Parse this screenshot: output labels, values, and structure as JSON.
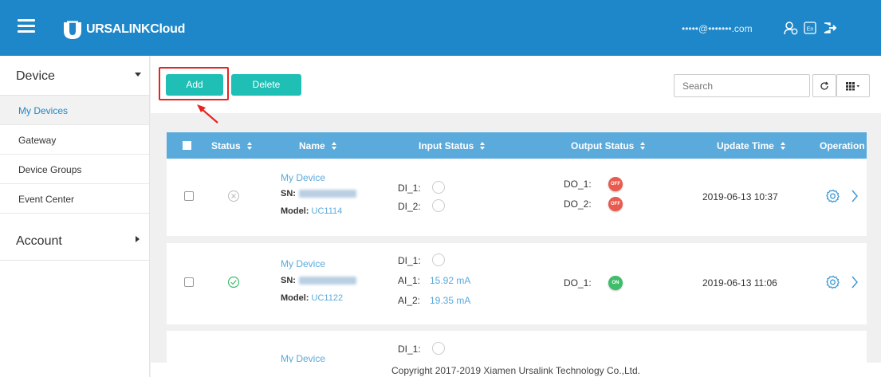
{
  "header": {
    "logo_text": "URSALINKCloud",
    "user_email": "•••••@•••••••.com",
    "icons": [
      "menu-icon",
      "user-switch-icon",
      "language-en-icon",
      "logout-icon"
    ],
    "lang_label": "En"
  },
  "sidebar": {
    "device_section": "Device",
    "items": [
      {
        "label": "My Devices",
        "active": true
      },
      {
        "label": "Gateway",
        "active": false
      },
      {
        "label": "Device Groups",
        "active": false
      },
      {
        "label": "Event Center",
        "active": false
      }
    ],
    "account_section": "Account"
  },
  "toolbar": {
    "add_label": "Add",
    "delete_label": "Delete",
    "search_placeholder": "Search"
  },
  "table": {
    "columns": [
      "Status",
      "Name",
      "Input Status",
      "Output Status",
      "Update Time",
      "Operation"
    ],
    "rows": [
      {
        "status": "offline",
        "name": "My Device",
        "sn_label": "SN:",
        "model_label": "Model:",
        "model": "UC1114",
        "inputs": [
          {
            "label": "DI_1:"
          },
          {
            "label": "DI_2:"
          }
        ],
        "outputs": [
          {
            "label": "DO_1:",
            "state": "OFF"
          },
          {
            "label": "DO_2:",
            "state": "OFF"
          }
        ],
        "update_time": "2019-06-13 10:37"
      },
      {
        "status": "online",
        "name": "My Device",
        "sn_label": "SN:",
        "model_label": "Model:",
        "model": "UC1122",
        "inputs": [
          {
            "label": "DI_1:"
          },
          {
            "label": "AI_1:",
            "value": "15.92 mA"
          },
          {
            "label": "AI_2:",
            "value": "19.35 mA"
          }
        ],
        "outputs": [
          {
            "label": "DO_1:",
            "state": "ON"
          }
        ],
        "update_time": "2019-06-13 11:06"
      },
      {
        "name": "My Device",
        "inputs": [
          {
            "label": "DI_1:"
          }
        ]
      }
    ]
  },
  "footer": {
    "copyright": "Copyright 2017-2019 Xiamen Ursalink Technology Co.,Ltd."
  },
  "colors": {
    "header_bg": "#1d87c9",
    "table_header_bg": "#5aaadc",
    "button_teal": "#1fbfb5",
    "annotation_red": "#e52420",
    "off_red": "#e95a4f",
    "on_green": "#3fbd6b"
  }
}
